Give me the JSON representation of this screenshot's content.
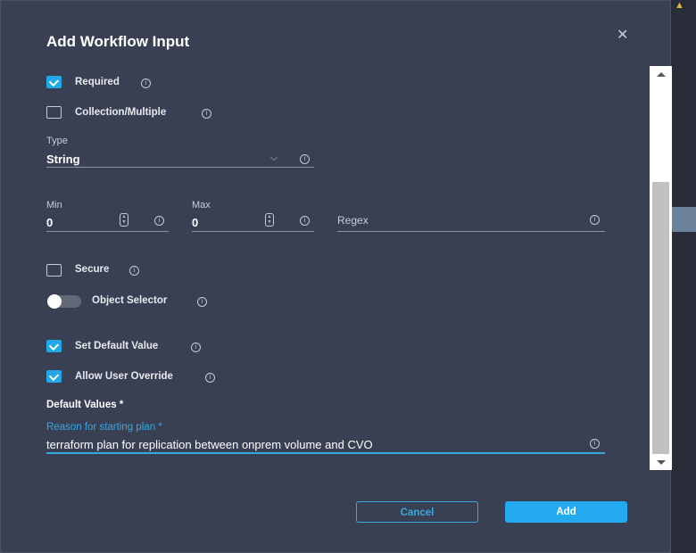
{
  "dialog": {
    "title": "Add Workflow Input"
  },
  "required": {
    "label": "Required",
    "checked": true
  },
  "collection": {
    "label": "Collection/Multiple",
    "checked": false
  },
  "type": {
    "label": "Type",
    "value": "String"
  },
  "min": {
    "label": "Min",
    "value": "0"
  },
  "max": {
    "label": "Max",
    "value": "0"
  },
  "regex": {
    "placeholder": "Regex"
  },
  "secure": {
    "label": "Secure",
    "checked": false
  },
  "object_selector": {
    "label": "Object Selector",
    "on": false
  },
  "set_default": {
    "label": "Set Default Value",
    "checked": true
  },
  "allow_override": {
    "label": "Allow User Override",
    "checked": true
  },
  "default_values": {
    "heading": "Default Values *"
  },
  "reason": {
    "label": "Reason for starting plan *",
    "value": "terraform plan for replication between onprem volume and CVO"
  },
  "buttons": {
    "cancel": "Cancel",
    "add": "Add"
  },
  "colors": {
    "accent": "#23aaef",
    "panel": "#394053"
  }
}
